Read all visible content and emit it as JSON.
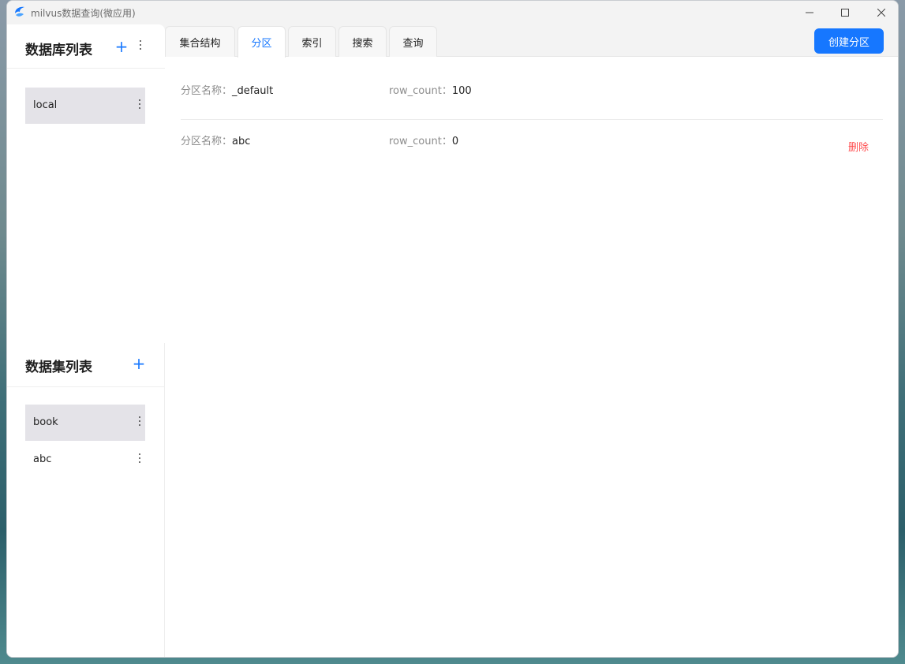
{
  "window": {
    "title": "milvus数据查询(微应用)",
    "controls": {
      "minimize": "─",
      "maximize": "□",
      "close": "✕"
    }
  },
  "db_panel": {
    "title": "数据库列表",
    "items": [
      {
        "label": "local",
        "selected": true
      }
    ]
  },
  "collection_panel": {
    "title": "数据集列表",
    "items": [
      {
        "label": "book",
        "selected": true
      },
      {
        "label": "abc",
        "selected": false
      }
    ]
  },
  "tabs": [
    {
      "label": "集合结构",
      "active": false
    },
    {
      "label": "分区",
      "active": true
    },
    {
      "label": "索引",
      "active": false
    },
    {
      "label": "搜索",
      "active": false
    },
    {
      "label": "查询",
      "active": false
    }
  ],
  "actions": {
    "create_partition": "创建分区",
    "delete": "删除"
  },
  "partitions": [
    {
      "name_label": "分区名称：",
      "name": "_default",
      "count_label": "row_count：",
      "count": "100"
    },
    {
      "name_label": "分区名称：",
      "name": "abc",
      "count_label": "row_count：",
      "count": "0"
    }
  ],
  "colors": {
    "accent": "#1677ff",
    "danger": "#ff4d4f",
    "selected_bg": "#e4e3e8"
  }
}
